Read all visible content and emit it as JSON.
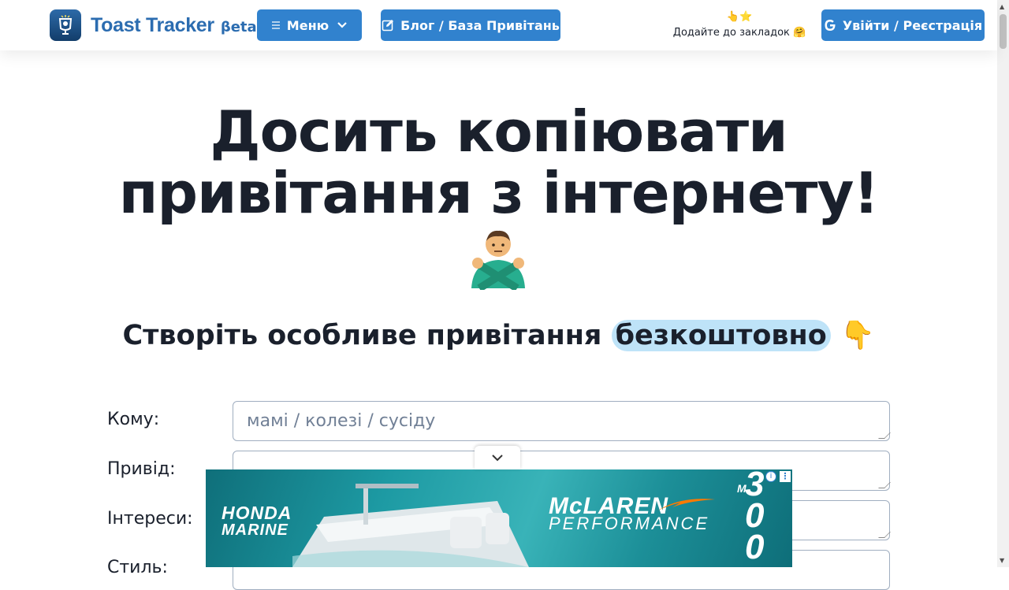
{
  "header": {
    "logo_text": "Toast Tracker",
    "logo_beta": "βeta",
    "menu_label": "Меню",
    "blog_label": "Блог / База Привітань",
    "bookmark_emoji": "👆⭐",
    "bookmark_text": "Додайте до закладок 🤗",
    "login_label": "Увійти / Реєстрація"
  },
  "hero": {
    "line1": "Досить копіювати",
    "line2": "привітання з інтернету!",
    "emoji": "🙅‍♂️"
  },
  "subtitle": {
    "before": "Створіть особливе привітання ",
    "highlight": "безкоштовно",
    "emoji": " 👇"
  },
  "form": {
    "fields": [
      {
        "label": "Кому:",
        "placeholder": "мамі / колезі / сусіду"
      },
      {
        "label": "Привід:",
        "placeholder": ""
      },
      {
        "label": "Інтереси:",
        "placeholder": ""
      },
      {
        "label": "Стиль:",
        "placeholder": ""
      }
    ]
  },
  "ad": {
    "brand_left": "HONDA MARINE",
    "brand_right": "McLAREN",
    "brand_right_sub": "PERFORMANCE",
    "model": "M300",
    "info_icon": "info-icon",
    "more_icon": "more-vertical-icon"
  },
  "colors": {
    "accent": "#3182ce",
    "brand": "#2b6cb0",
    "highlight": "#bee3f8",
    "text": "#1a202c"
  }
}
